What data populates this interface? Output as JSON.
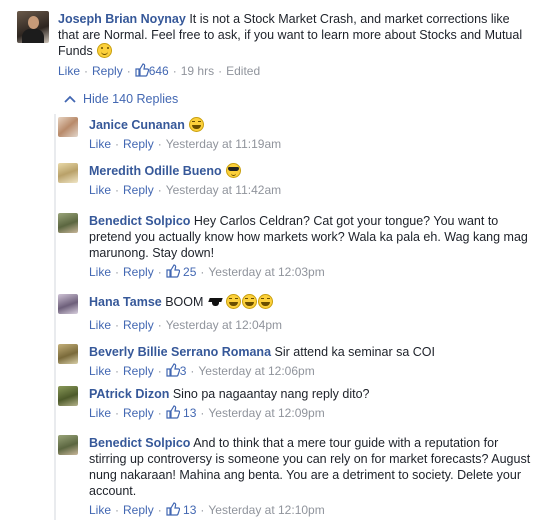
{
  "main_comment": {
    "author": "Joseph Brian Noynay",
    "text": "It is not a Stock Market Crash, and market corrections like that are Normal. Feel free to ask, if you want to learn more about Stocks and Mutual Funds",
    "emoji": "smile-emoji",
    "like_label": "Like",
    "reply_label": "Reply",
    "like_count": "646",
    "time": "19 hrs",
    "edited": "Edited"
  },
  "hide_replies": {
    "label": "Hide 140 Replies",
    "icon": "chevron-up-icon"
  },
  "colors": {
    "name": "#365899",
    "link": "#4267b2",
    "meta": "#90949c",
    "text": "#1d2129"
  },
  "replies": [
    {
      "author": "Janice Cunanan",
      "text": "",
      "emoji": "laugh",
      "like_label": "Like",
      "reply_label": "Reply",
      "like_count": "",
      "time": "Yesterday at 11:19am"
    },
    {
      "author": "Meredith Odille Bueno",
      "text": "",
      "emoji": "cool",
      "like_label": "Like",
      "reply_label": "Reply",
      "like_count": "",
      "time": "Yesterday at 11:42am"
    },
    {
      "author": "Benedict Solpico",
      "text": "Hey Carlos Celdran? Cat got your tongue? You want to pretend you actually know how markets work? Wala ka pala eh. Wag kang mag marunong. Stay down!",
      "emoji": "",
      "like_label": "Like",
      "reply_label": "Reply",
      "like_count": "25",
      "time": "Yesterday at 12:03pm"
    },
    {
      "author": "Hana Tamse",
      "text": "BOOM",
      "emoji": "graduation-cap + laugh x3",
      "like_label": "Like",
      "reply_label": "Reply",
      "like_count": "",
      "time": "Yesterday at 12:04pm"
    },
    {
      "author": "Beverly Billie Serrano Romana",
      "text": "Sir attend ka seminar sa COI",
      "emoji": "",
      "like_label": "Like",
      "reply_label": "Reply",
      "like_count": "3",
      "time": "Yesterday at 12:06pm"
    },
    {
      "author": "PAtrick Dizon",
      "text": "Sino pa nagaantay nang reply dito?",
      "emoji": "",
      "like_label": "Like",
      "reply_label": "Reply",
      "like_count": "13",
      "time": "Yesterday at 12:09pm"
    },
    {
      "author": "Benedict Solpico",
      "text": "And to think that a mere tour guide with a reputation for stirring up controversy is someone you can rely on for market forecasts? August nung nakaraan! Mahina ang benta. You are a detriment to society. Delete your account.",
      "emoji": "",
      "like_label": "Like",
      "reply_label": "Reply",
      "like_count": "13",
      "time": "Yesterday at 12:10pm"
    }
  ]
}
